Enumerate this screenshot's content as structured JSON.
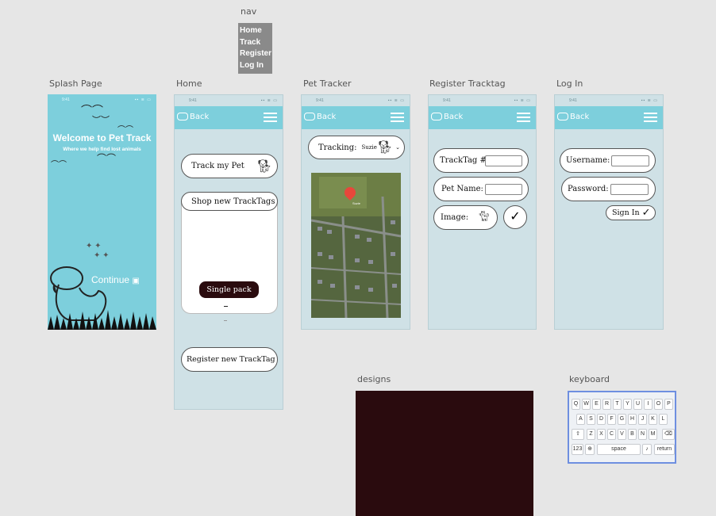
{
  "nav": {
    "label": "nav",
    "items": [
      "Home",
      "Track",
      "Register",
      "Log In"
    ]
  },
  "frames": {
    "splash": "Splash Page",
    "home": "Home",
    "tracker": "Pet Tracker",
    "register": "Register Tracktag",
    "login": "Log In",
    "designs": "designs",
    "keyboard": "keyboard"
  },
  "status": {
    "time": "9:41",
    "signal": "▪▪ ≋ ▭"
  },
  "topbar": {
    "back": "Back"
  },
  "splash": {
    "title": "Welcome to Pet Track",
    "subtitle": "Where we help find lost animals",
    "continue": "Continue"
  },
  "home": {
    "track": "Track my Pet",
    "shop": "Shop new TrackTags",
    "single_pack": "Single pack",
    "register": "Register new TrackTag"
  },
  "tracker": {
    "tracking_label": "Tracking:",
    "pet": "Suzie",
    "map_pin_label": "Suzie"
  },
  "register": {
    "tracktag": "TrackTag #:",
    "pet_name": "Pet Name:",
    "image": "Image:"
  },
  "login": {
    "username": "Username:",
    "password": "Password:",
    "sign_in": "Sign In"
  },
  "keyboard": {
    "row1": [
      "Q",
      "W",
      "E",
      "R",
      "T",
      "Y",
      "U",
      "I",
      "O",
      "P"
    ],
    "row2": [
      "A",
      "S",
      "D",
      "F",
      "G",
      "H",
      "J",
      "K",
      "L"
    ],
    "row3": [
      "Z",
      "X",
      "C",
      "V",
      "B",
      "N",
      "M"
    ],
    "num": "123",
    "space": "space",
    "return": "return"
  },
  "colors": {
    "accent": "#7dcfdc",
    "phone_bg": "#cfe1e6",
    "dark": "#2a0b0e"
  }
}
